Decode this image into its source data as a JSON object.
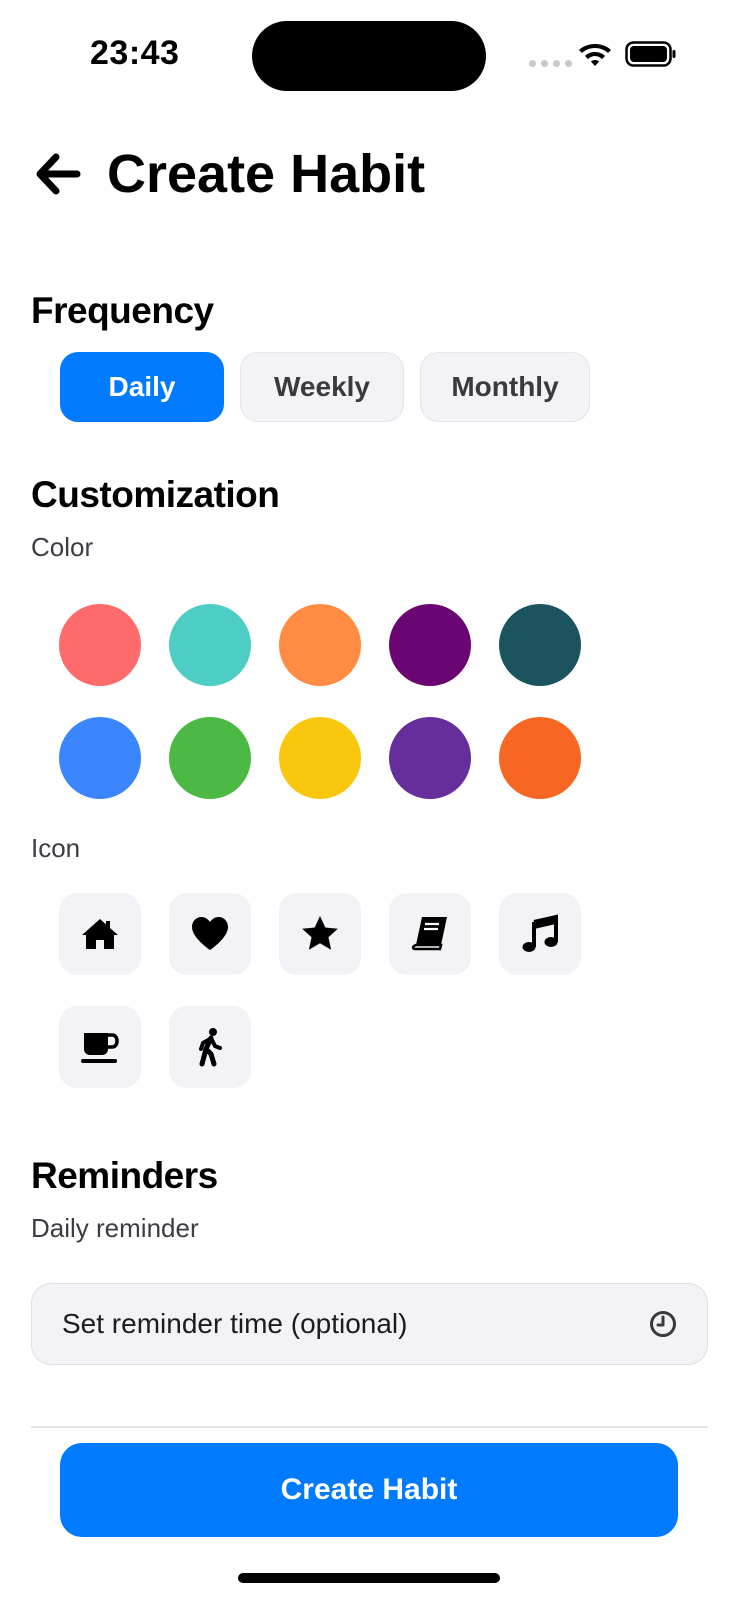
{
  "status": {
    "time": "23:43"
  },
  "header": {
    "title": "Create Habit",
    "back_icon": "arrow-left-icon"
  },
  "frequency": {
    "title": "Frequency",
    "options": [
      "Daily",
      "Weekly",
      "Monthly"
    ],
    "selected": "Daily",
    "accent": "#007aff"
  },
  "customization": {
    "title": "Customization",
    "color_label": "Color",
    "colors": [
      "#ff6b6b",
      "#4ecdc4",
      "#ff8c42",
      "#6a0572",
      "#1b535e",
      "#3b86ff",
      "#4cb944",
      "#f9c80e",
      "#662e9b",
      "#f86624"
    ],
    "icon_label": "Icon",
    "icons": [
      "home-icon",
      "heart-icon",
      "star-icon",
      "book-icon",
      "music-icon",
      "coffee-icon",
      "walking-icon"
    ]
  },
  "reminders": {
    "title": "Reminders",
    "label": "Daily reminder",
    "placeholder": "Set reminder time (optional)",
    "icon": "clock-icon"
  },
  "footer": {
    "create_label": "Create Habit"
  }
}
